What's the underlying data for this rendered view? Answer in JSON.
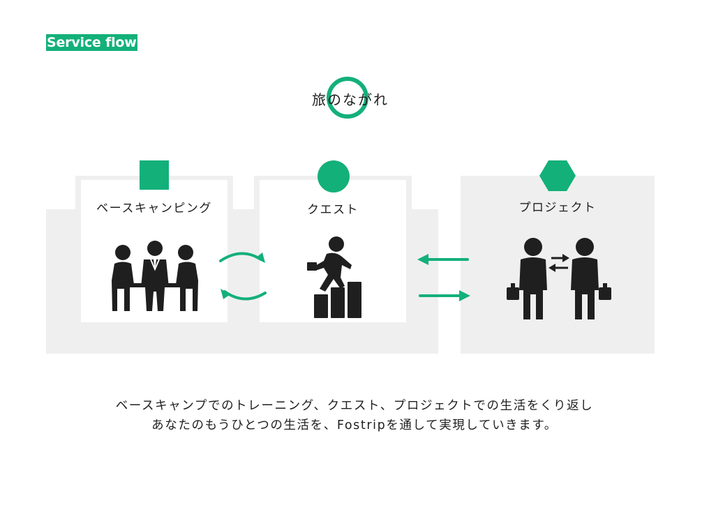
{
  "section_tag": "Service flow",
  "heading": "旅のながれ",
  "colors": {
    "accent": "#13b07a",
    "panel": "#efefef",
    "ink": "#1f1f1f"
  },
  "steps": [
    {
      "label": "ベースキャンピング",
      "marker": "square",
      "icon": "team-meeting-icon"
    },
    {
      "label": "クエスト",
      "marker": "circle",
      "icon": "climbing-steps-icon"
    },
    {
      "label": "プロジェクト",
      "marker": "hexagon",
      "icon": "business-exchange-icon"
    }
  ],
  "caption": {
    "line1": "ベースキャンプでのトレーニング、クエスト、プロジェクトでの生活をくり返し",
    "line2": "あなたのもうひとつの生活を、Fostripを通して実現していきます。"
  }
}
